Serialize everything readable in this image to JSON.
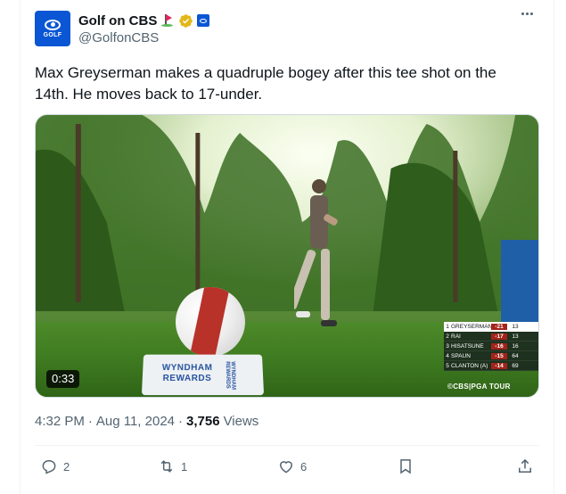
{
  "author": {
    "display_name": "Golf on CBS",
    "handle": "@GolfonCBS",
    "avatar_text": "GOLF",
    "icons": [
      "golf-flag-icon",
      "verified-gold-icon",
      "cbs-affiliate-icon"
    ]
  },
  "tweet": {
    "text": "Max Greyserman makes a quadruple bogey after this tee shot on the 14th. He moves back to 17-under."
  },
  "media": {
    "duration": "0:33",
    "tee_sign_line1": "WYNDHAM",
    "tee_sign_line2": "REWARDS",
    "tee_sign_side": "WYNDHAM REWARDS",
    "watermark": "©CBS|PGA TOUR",
    "leaderboard": [
      {
        "pos": "1",
        "name": "GREYSERMAN",
        "score": "-21",
        "thru": "13"
      },
      {
        "pos": "2",
        "name": "RAI",
        "score": "-17",
        "thru": "13"
      },
      {
        "pos": "3",
        "name": "HISATSUNE",
        "score": "-16",
        "thru": "16"
      },
      {
        "pos": "4",
        "name": "SPAUN",
        "score": "-15",
        "thru": "64"
      },
      {
        "pos": "5",
        "name": "CLANTON (A)",
        "score": "-14",
        "thru": "69"
      }
    ]
  },
  "meta": {
    "time": "4:32 PM",
    "sep1": "·",
    "date": "Aug 11, 2024",
    "sep2": "·",
    "views_count": "3,756",
    "views_label": "Views"
  },
  "actions": {
    "replies": "2",
    "reposts": "1",
    "likes": "6"
  },
  "colors": {
    "text_primary": "#0f1419",
    "text_secondary": "#536471",
    "brand_blue": "#0b56d4",
    "leaderboard_red": "#a3231a"
  }
}
